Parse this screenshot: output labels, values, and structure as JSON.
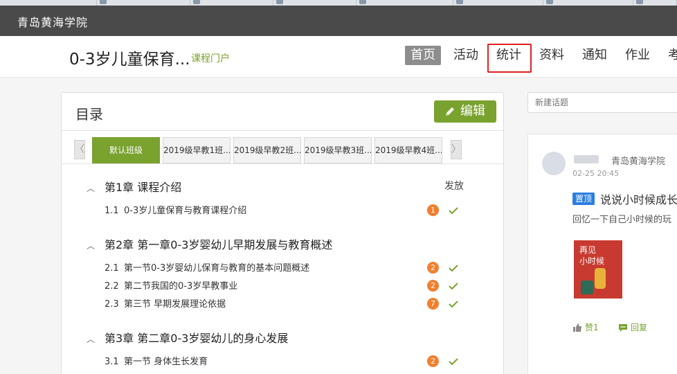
{
  "header": {
    "school_name": "青岛黄海学院"
  },
  "course": {
    "title": "0-3岁儿童保育...",
    "portal_link": "课程门户",
    "nav": [
      "首页",
      "活动",
      "统计",
      "资料",
      "通知",
      "作业",
      "考"
    ],
    "active_nav": "首页",
    "highlighted_nav": "统计"
  },
  "catalog": {
    "title": "目录",
    "edit_label": "编辑",
    "prev_arrow": "〈",
    "next_arrow": "〉",
    "class_tabs": [
      "默认班级",
      "2019级早教1班...",
      "2019级早教2班...",
      "2019级早教3班...",
      "2019级早教4班..."
    ],
    "publish_label": "发放",
    "chapters": [
      {
        "title": "第1章 课程介绍",
        "sections": [
          {
            "num": "1.1",
            "title": "0-3岁儿童保育与教育课程介绍",
            "count": "1"
          }
        ]
      },
      {
        "title": "第2章 第一章0-3岁婴幼儿早期发展与教育概述",
        "sections": [
          {
            "num": "2.1",
            "title": "第一节0-3岁婴幼儿保育与教育的基本问题概述",
            "count": "2"
          },
          {
            "num": "2.2",
            "title": "第二节我国的0-3岁早教事业",
            "count": "2"
          },
          {
            "num": "2.3",
            "title": "第三节 早期发展理论依据",
            "count": "7"
          }
        ]
      },
      {
        "title": "第3章 第二章0-3岁婴幼儿的身心发展",
        "sections": [
          {
            "num": "3.1",
            "title": "第一节 身体生长发育",
            "count": "2"
          }
        ]
      }
    ]
  },
  "topic": {
    "placeholder": "新建话题"
  },
  "post": {
    "author_school": "青岛黄海学院",
    "date": "02-25 20:45",
    "pin_label": "置顶",
    "title": "说说小时候成长",
    "excerpt": "回忆一下自己小时候的玩",
    "image_text": "再见\n小时候",
    "like_label": "赞1",
    "reply_label": "回复"
  },
  "colors": {
    "accent_green": "#79a22e",
    "badge_orange": "#f08030",
    "pin_blue": "#2a7de0",
    "highlight_red": "#e02020"
  }
}
